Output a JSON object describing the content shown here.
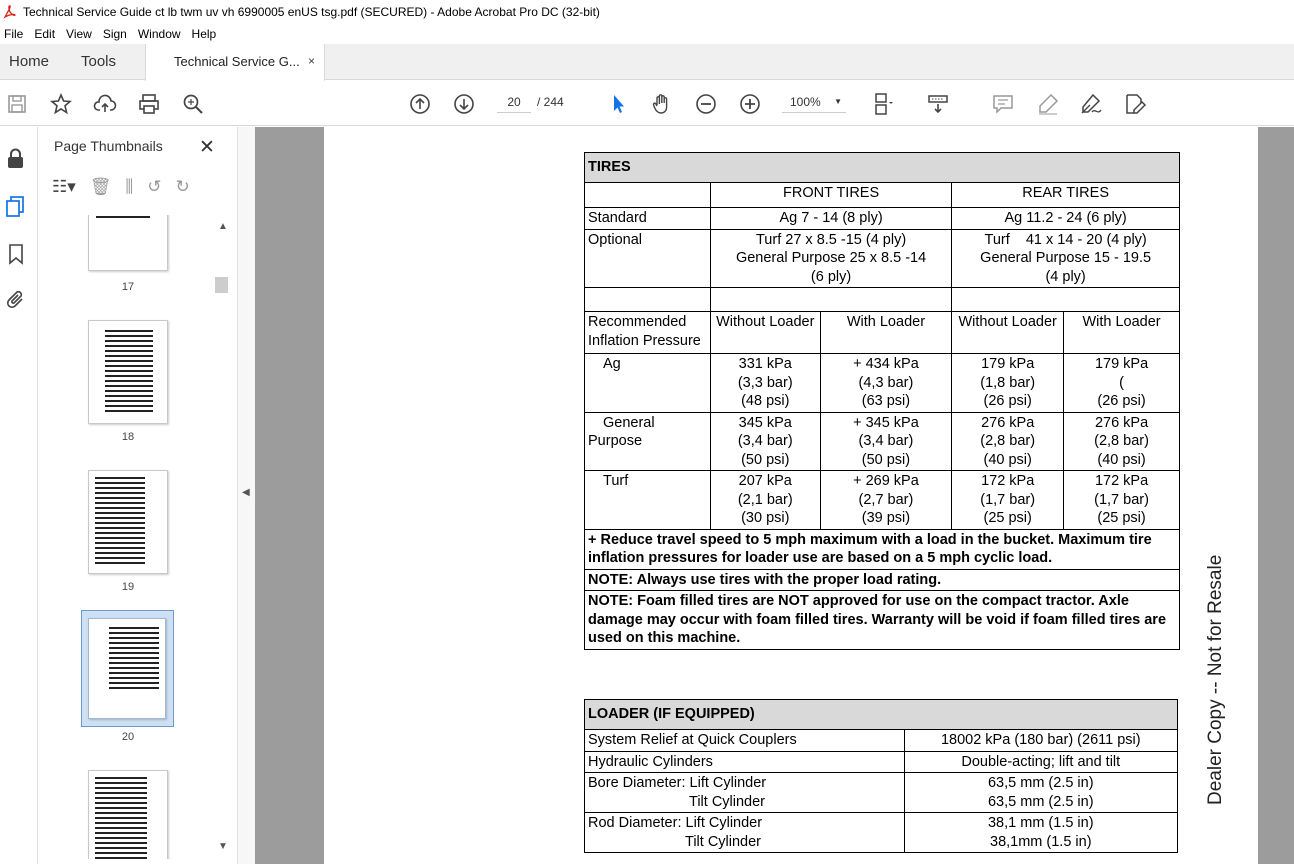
{
  "window": {
    "title": "Technical Service Guide ct lb twm uv vh 6990005 enUS tsg.pdf (SECURED) - Adobe Acrobat Pro DC (32-bit)"
  },
  "menu": [
    "File",
    "Edit",
    "View",
    "Sign",
    "Window",
    "Help"
  ],
  "tabs": {
    "home": "Home",
    "tools": "Tools",
    "doc": "Technical Service G...",
    "close": "×"
  },
  "toolbar": {
    "page_current": "20",
    "page_total": "/  244",
    "zoom": "100%"
  },
  "panel": {
    "title": "Page Thumbnails",
    "close": "✕",
    "thumbs": [
      "17",
      "18",
      "19",
      "20"
    ]
  },
  "watermark": "Dealer Copy -- Not for Resale",
  "tires": {
    "title": "TIRES",
    "front_header": "FRONT TIRES",
    "rear_header": "REAR TIRES",
    "standard": {
      "label": "Standard",
      "front": "Ag 7 - 14 (8 ply)",
      "rear": "Ag 11.2 - 24 (6 ply)"
    },
    "optional": {
      "label": "Optional",
      "front_1": "Turf 27 x 8.5 -15 (4 ply)",
      "front_2": "General Purpose 25 x 8.5 -14",
      "front_3": "(6 ply)",
      "rear_1": "Turf    41 x 14 - 20 (4 ply)",
      "rear_2": "General Purpose 15 - 19.5",
      "rear_3": "(4 ply)"
    },
    "pressure_label_1": "Recommended",
    "pressure_label_2": "Inflation Pressure",
    "without_loader": "Without Loader",
    "with_loader": "With Loader",
    "rows": [
      {
        "label": "Ag",
        "cells": [
          [
            "331 kPa",
            "(3,3 bar)",
            "(48 psi)"
          ],
          [
            "+ 434 kPa",
            "(4,3 bar)",
            "(63 psi)"
          ],
          [
            "179 kPa",
            "(1,8 bar)",
            "(26 psi)"
          ],
          [
            "179 kPa",
            "(",
            "(26 psi)"
          ]
        ]
      },
      {
        "label": "General",
        "label2": "Purpose",
        "cells": [
          [
            "345 kPa",
            "(3,4 bar)",
            "(50 psi)"
          ],
          [
            "+ 345 kPa",
            "(3,4 bar)",
            "(50 psi)"
          ],
          [
            "276 kPa",
            "(2,8 bar)",
            "(40 psi)"
          ],
          [
            "276 kPa",
            "(2,8 bar)",
            "(40 psi)"
          ]
        ]
      },
      {
        "label": "Turf",
        "cells": [
          [
            "207 kPa",
            "(2,1 bar)",
            "(30 psi)"
          ],
          [
            "+ 269 kPa",
            "(2,7 bar)",
            "(39 psi)"
          ],
          [
            "172 kPa",
            "(1,7 bar)",
            "(25 psi)"
          ],
          [
            "172 kPa",
            "(1,7 bar)",
            "(25 psi)"
          ]
        ]
      }
    ],
    "note_speed": "+ Reduce travel speed to 5 mph maximum with a load in the bucket. Maximum tire inflation pressures for loader use are based on a 5 mph cyclic load.",
    "note_rating": "NOTE: Always use tires with the proper load rating.",
    "note_foam": "NOTE: Foam filled tires are NOT approved for use on the compact tractor. Axle damage may occur with foam filled tires. Warranty will be void if foam filled tires are used on this machine."
  },
  "loader": {
    "title": "LOADER (IF EQUIPPED)",
    "relief": {
      "label": "System Relief at Quick Couplers",
      "value": "18002 kPa (180 bar) (2611 psi)"
    },
    "cylinders": {
      "label": "Hydraulic Cylinders",
      "value": "Double-acting; lift and tilt"
    },
    "bore": {
      "label_1": "Bore Diameter: Lift Cylinder",
      "label_2": "Tilt Cylinder",
      "value_1": "63,5 mm (2.5 in)",
      "value_2": "63,5 mm (2.5 in)"
    },
    "rod": {
      "label_1": "Rod Diameter: Lift Cylinder",
      "label_2": "Tilt Cylinder",
      "value_1": "38,1 mm (1.5 in)",
      "value_2": "38,1mm (1.5 in)"
    }
  }
}
